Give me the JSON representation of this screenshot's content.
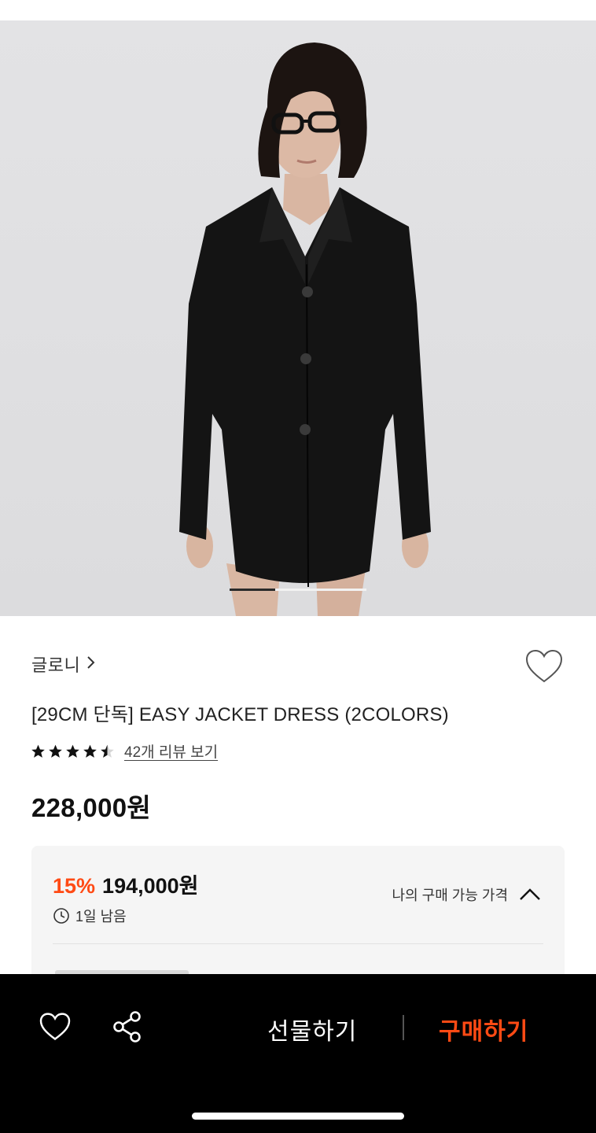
{
  "product": {
    "brand": "글로니",
    "title": "[29CM 단독] EASY JACKET DRESS (2COLORS)",
    "rating": 4.5,
    "review_link": "42개 리뷰 보기",
    "price": "228,000원"
  },
  "carousel": {
    "current_page": 1,
    "total_pages": 3
  },
  "discount": {
    "percent": "15%",
    "price": "194,000원",
    "remaining": "1일 남음",
    "my_price_label": "나의 구매 가능 가격"
  },
  "bottom_bar": {
    "gift_label": "선물하기",
    "buy_label": "구매하기"
  },
  "colors": {
    "accent": "#ff4a14",
    "bar": "#000000"
  },
  "icons": [
    "chevron-right-icon",
    "heart-outline-icon",
    "star-icon",
    "star-half-icon",
    "clock-icon",
    "chevron-up-icon",
    "share-icon"
  ]
}
